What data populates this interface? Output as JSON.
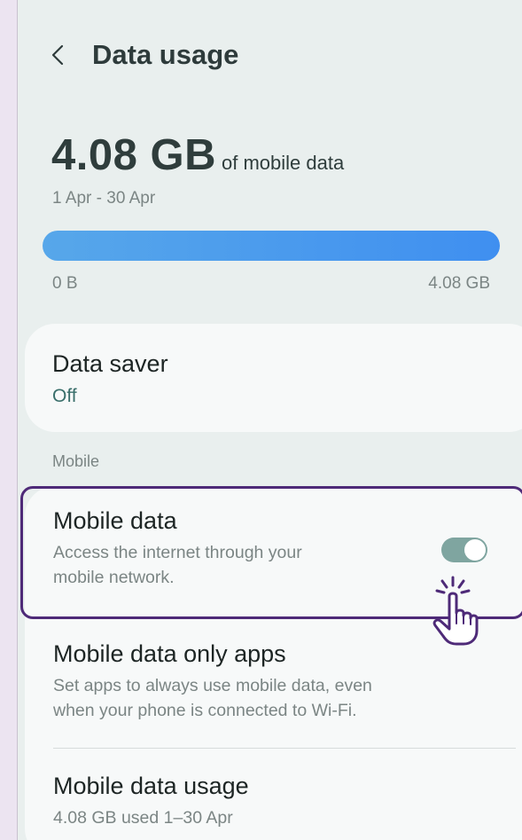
{
  "header": {
    "title": "Data usage",
    "back_icon": "chevron-left-icon"
  },
  "usage": {
    "amount": "4.08 GB",
    "suffix": "of mobile data",
    "period": "1 Apr - 30 Apr",
    "bar_fill_fraction": 1.0,
    "range_start": "0 B",
    "range_end": "4.08 GB"
  },
  "data_saver": {
    "title": "Data saver",
    "status": "Off"
  },
  "section_mobile": "Mobile",
  "mobile_data": {
    "title": "Mobile data",
    "subtitle_line1": "Access the internet through your",
    "subtitle_line2": "mobile network.",
    "toggle_on": true
  },
  "mobile_data_only_apps": {
    "title": "Mobile data only apps",
    "subtitle_line1": "Set apps to always use mobile data, even",
    "subtitle_line2": "when your phone is connected to Wi-Fi."
  },
  "mobile_data_usage": {
    "title": "Mobile data usage",
    "subtitle": "4.08 GB used 1–30 Apr"
  },
  "colors": {
    "accent": "#4e2a78",
    "progress_bar": "#3f8ff0",
    "toggle_on": "#7fa5a0",
    "status_text": "#3a6f6b"
  },
  "icons": {
    "tap_cursor": "pointing-hand-icon"
  }
}
